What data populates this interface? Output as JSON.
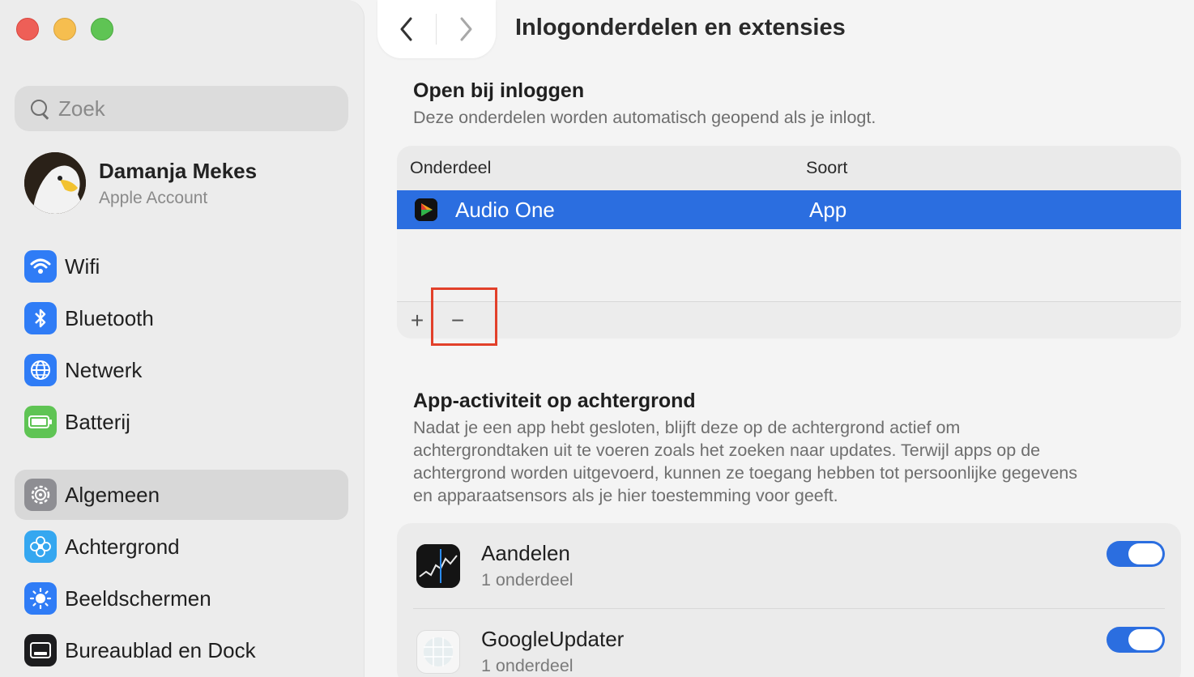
{
  "window": {
    "title": "Inlogonderdelen en extensies"
  },
  "sidebar": {
    "search_placeholder": "Zoek",
    "account": {
      "name": "Damanja Mekes",
      "subtitle": "Apple Account"
    },
    "items": [
      {
        "label": "Wifi",
        "icon": "wifi-icon",
        "color": "#2f7cf6"
      },
      {
        "label": "Bluetooth",
        "icon": "bluetooth-icon",
        "color": "#2f7cf6"
      },
      {
        "label": "Netwerk",
        "icon": "globe-icon",
        "color": "#2f7cf6"
      },
      {
        "label": "Batterij",
        "icon": "battery-icon",
        "color": "#5fc454"
      },
      {
        "label": "Algemeen",
        "icon": "gear-icon",
        "color": "#8e8e93",
        "selected": true
      },
      {
        "label": "Achtergrond",
        "icon": "flower-icon",
        "color": "#35a7f0"
      },
      {
        "label": "Beeldschermen",
        "icon": "sun-icon",
        "color": "#2f7cf6"
      },
      {
        "label": "Bureaublad en Dock",
        "icon": "dock-icon",
        "color": "#1c1c1e"
      }
    ]
  },
  "login": {
    "title": "Open bij inloggen",
    "description": "Deze onderdelen worden automatisch geopend als je inlogt.",
    "columns": {
      "item": "Onderdeel",
      "type": "Soort"
    },
    "rows": [
      {
        "name": "Audio One",
        "type": "App",
        "selected": true
      }
    ],
    "add_label": "+",
    "remove_label": "−"
  },
  "background": {
    "title": "App-activiteit op achtergrond",
    "description": [
      "Nadat je een app hebt gesloten, blijft deze op de achtergrond actief om",
      "achtergrondtaken uit te voeren zoals het zoeken naar updates. Terwijl apps op de",
      "achtergrond worden uitgevoerd, kunnen ze toegang hebben tot persoonlijke gegevens",
      "en apparaatsensors als je hier toestemming voor geeft."
    ],
    "apps": [
      {
        "name": "Aandelen",
        "sub": "1 onderdeel",
        "enabled": true
      },
      {
        "name": "GoogleUpdater",
        "sub": "1 onderdeel",
        "enabled": true
      }
    ]
  },
  "colors": {
    "accent": "#2b6ee0",
    "highlight": "#e2402a"
  }
}
